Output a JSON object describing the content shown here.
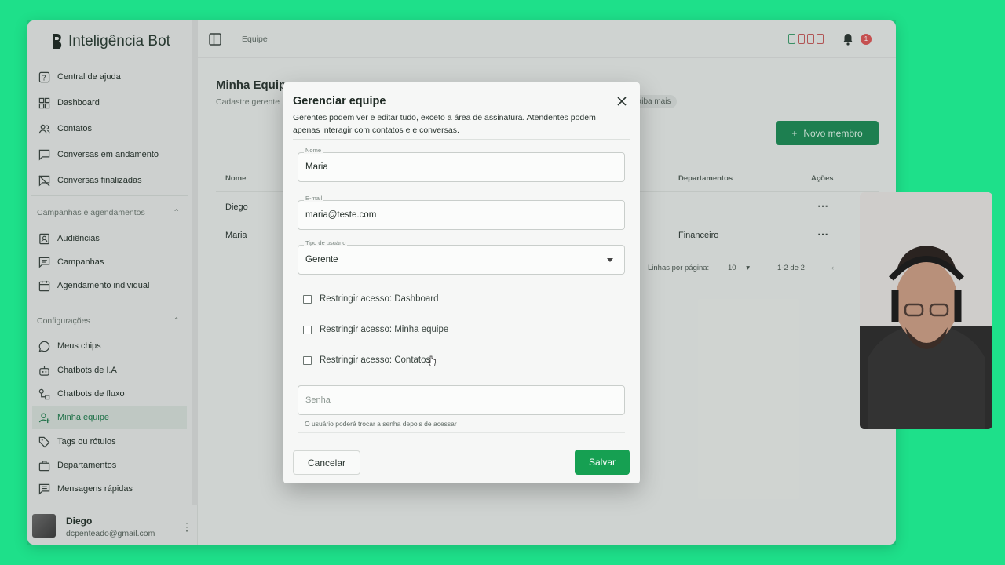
{
  "app": {
    "name": "Inteligência Bot"
  },
  "sidebar": {
    "items": [
      {
        "label": "Central de ajuda",
        "icon": "help-icon"
      },
      {
        "label": "Dashboard",
        "icon": "dashboard-icon"
      },
      {
        "label": "Contatos",
        "icon": "contacts-icon"
      },
      {
        "label": "Conversas em andamento",
        "icon": "chat-icon"
      },
      {
        "label": "Conversas finalizadas",
        "icon": "chat-off-icon"
      }
    ],
    "section_campaigns": {
      "title": "Campanhas e agendamentos",
      "items": [
        {
          "label": "Audiências",
          "icon": "audience-icon"
        },
        {
          "label": "Campanhas",
          "icon": "campaign-icon"
        },
        {
          "label": "Agendamento individual",
          "icon": "calendar-icon"
        }
      ]
    },
    "section_settings": {
      "title": "Configurações",
      "items": [
        {
          "label": "Meus chips",
          "icon": "whatsapp-icon"
        },
        {
          "label": "Chatbots de I.A",
          "icon": "ai-bot-icon"
        },
        {
          "label": "Chatbots de fluxo",
          "icon": "flow-icon"
        },
        {
          "label": "Minha equipe",
          "icon": "team-icon",
          "active": true
        },
        {
          "label": "Tags ou rótulos",
          "icon": "tag-icon"
        },
        {
          "label": "Departamentos",
          "icon": "briefcase-icon"
        },
        {
          "label": "Mensagens rápidas",
          "icon": "quick-message-icon"
        }
      ]
    },
    "user": {
      "name": "Diego",
      "email": "dcpenteado@gmail.com"
    }
  },
  "topbar": {
    "breadcrumb": "Equipe",
    "notification_count": "1"
  },
  "page": {
    "title": "Minha Equipe",
    "subtitle": "Cadastre gerente",
    "learn_more": "Saiba mais",
    "new_member": "Novo membro",
    "table": {
      "headers": {
        "name": "Nome",
        "departments": "Departamentos",
        "actions": "Ações"
      },
      "rows": [
        {
          "name": "Diego",
          "departments": ""
        },
        {
          "name": "Maria",
          "departments": "Financeiro"
        }
      ]
    },
    "pagination": {
      "rows_per_page_label": "Linhas por página:",
      "rows_per_page": "10",
      "range": "1-2 de 2"
    }
  },
  "dialog": {
    "title": "Gerenciar equipe",
    "description": "Gerentes podem ver e editar tudo, exceto a área de assinatura. Atendentes podem apenas interagir com contatos e e conversas.",
    "name": {
      "label": "Nome",
      "value": "Maria"
    },
    "email": {
      "label": "E-mail",
      "value": "maria@teste.com"
    },
    "user_type": {
      "label": "Tipo de usuário",
      "value": "Gerente"
    },
    "restrictions": [
      {
        "label": "Restringir acesso: Dashboard",
        "checked": false
      },
      {
        "label": "Restringir acesso: Minha equipe",
        "checked": false
      },
      {
        "label": "Restringir acesso: Contatos",
        "checked": false
      }
    ],
    "password": {
      "placeholder": "Senha",
      "hint": "O usuário poderá trocar a senha depois de acessar"
    },
    "cancel_label": "Cancelar",
    "save_label": "Salvar"
  },
  "colors": {
    "background": "#1ee08a",
    "accent": "#16a052",
    "badge": "#d95555"
  }
}
